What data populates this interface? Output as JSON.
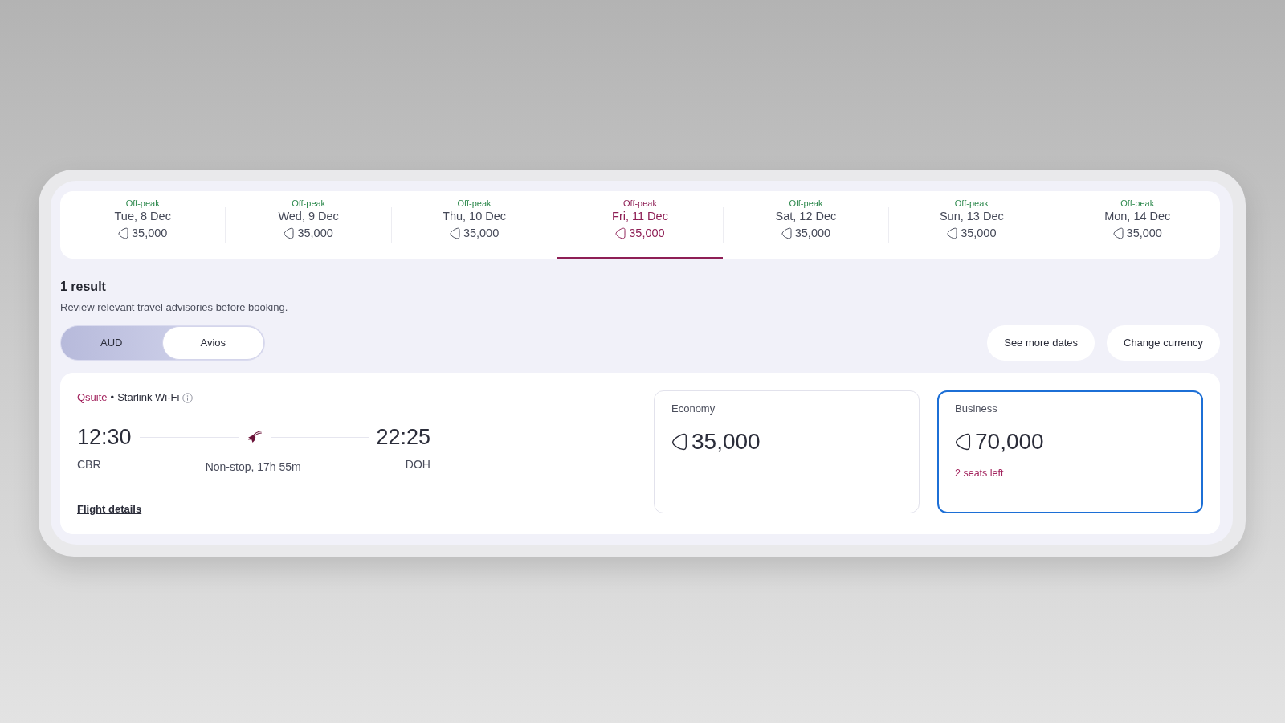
{
  "date_strip": [
    {
      "tag": "Off-peak",
      "date": "Tue, 8 Dec",
      "price": "35,000",
      "selected": false
    },
    {
      "tag": "Off-peak",
      "date": "Wed, 9 Dec",
      "price": "35,000",
      "selected": false
    },
    {
      "tag": "Off-peak",
      "date": "Thu, 10 Dec",
      "price": "35,000",
      "selected": false
    },
    {
      "tag": "Off-peak",
      "date": "Fri, 11 Dec",
      "price": "35,000",
      "selected": true
    },
    {
      "tag": "Off-peak",
      "date": "Sat, 12 Dec",
      "price": "35,000",
      "selected": false
    },
    {
      "tag": "Off-peak",
      "date": "Sun, 13 Dec",
      "price": "35,000",
      "selected": false
    },
    {
      "tag": "Off-peak",
      "date": "Mon, 14 Dec",
      "price": "35,000",
      "selected": false
    }
  ],
  "results": {
    "heading": "1 result",
    "advisory": "Review relevant travel advisories before booking."
  },
  "price_toggle": [
    {
      "label": "AUD",
      "selected": false
    },
    {
      "label": "Avios",
      "selected": true
    }
  ],
  "actions": [
    "See more dates",
    "Change currency"
  ],
  "flight": {
    "cabin_product": "Qsuite",
    "separator": "•",
    "wifi": "Starlink Wi-Fi",
    "departure_time": "12:30",
    "departure_airport": "CBR",
    "duration": "Non-stop, 17h 55m",
    "arrival_time": "22:25",
    "arrival_airport": "DOH",
    "details_link": "Flight details"
  },
  "fares": [
    {
      "cabin": "Economy",
      "price": "35,000",
      "selected": false
    },
    {
      "cabin": "Business",
      "price": "70,000",
      "note": "2 seats left",
      "selected": true
    }
  ]
}
